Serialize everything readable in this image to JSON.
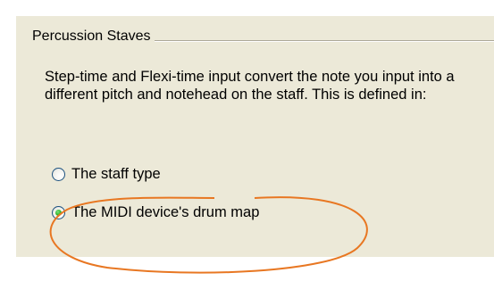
{
  "group": {
    "title": "Percussion Staves"
  },
  "description": "Step-time and Flexi-time input convert the note you input into a different pitch and notehead on the staff. This is defined in:",
  "options": [
    {
      "label": "The staff type",
      "selected": false
    },
    {
      "label": "The MIDI device's drum map",
      "selected": true
    }
  ],
  "colors": {
    "panel_background": "#ece9d8",
    "highlight_ellipse": "#e87722",
    "radio_selected_dot": "#2cb52c"
  }
}
